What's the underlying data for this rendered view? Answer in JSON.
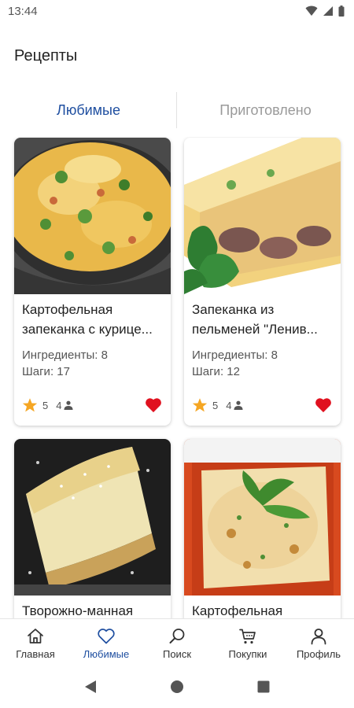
{
  "status_bar": {
    "time": "13:44"
  },
  "header": {
    "title": "Рецепты"
  },
  "tabs": [
    {
      "label": "Любимые",
      "active": true
    },
    {
      "label": "Приготовлено",
      "active": false
    }
  ],
  "recipes": [
    {
      "title": "Картофельная запеканка с курице...",
      "ingredients": "Ингредиенты: 8",
      "steps": "Шаги: 17",
      "rating": "5",
      "people": "4",
      "favorite": true
    },
    {
      "title": "Запеканка из пельменей \"Ленив...",
      "ingredients": "Ингредиенты: 8",
      "steps": "Шаги: 12",
      "rating": "5",
      "people": "4",
      "favorite": true
    },
    {
      "title": "Творожно-манная",
      "ingredients": "",
      "steps": "",
      "rating": "",
      "people": "",
      "favorite": true
    },
    {
      "title": "Картофельная",
      "ingredients": "",
      "steps": "",
      "rating": "",
      "people": "",
      "favorite": true
    }
  ],
  "bottom_nav": [
    {
      "label": "Главная",
      "icon": "home-icon",
      "active": false
    },
    {
      "label": "Любимые",
      "icon": "heart-icon",
      "active": true
    },
    {
      "label": "Поиск",
      "icon": "search-icon",
      "active": false
    },
    {
      "label": "Покупки",
      "icon": "cart-icon",
      "active": false
    },
    {
      "label": "Профиль",
      "icon": "profile-icon",
      "active": false
    }
  ],
  "colors": {
    "accent": "#1f4fa0",
    "favorite": "#e0111f",
    "star": "#f5a623",
    "inactive_tab": "#9a9a9a"
  }
}
